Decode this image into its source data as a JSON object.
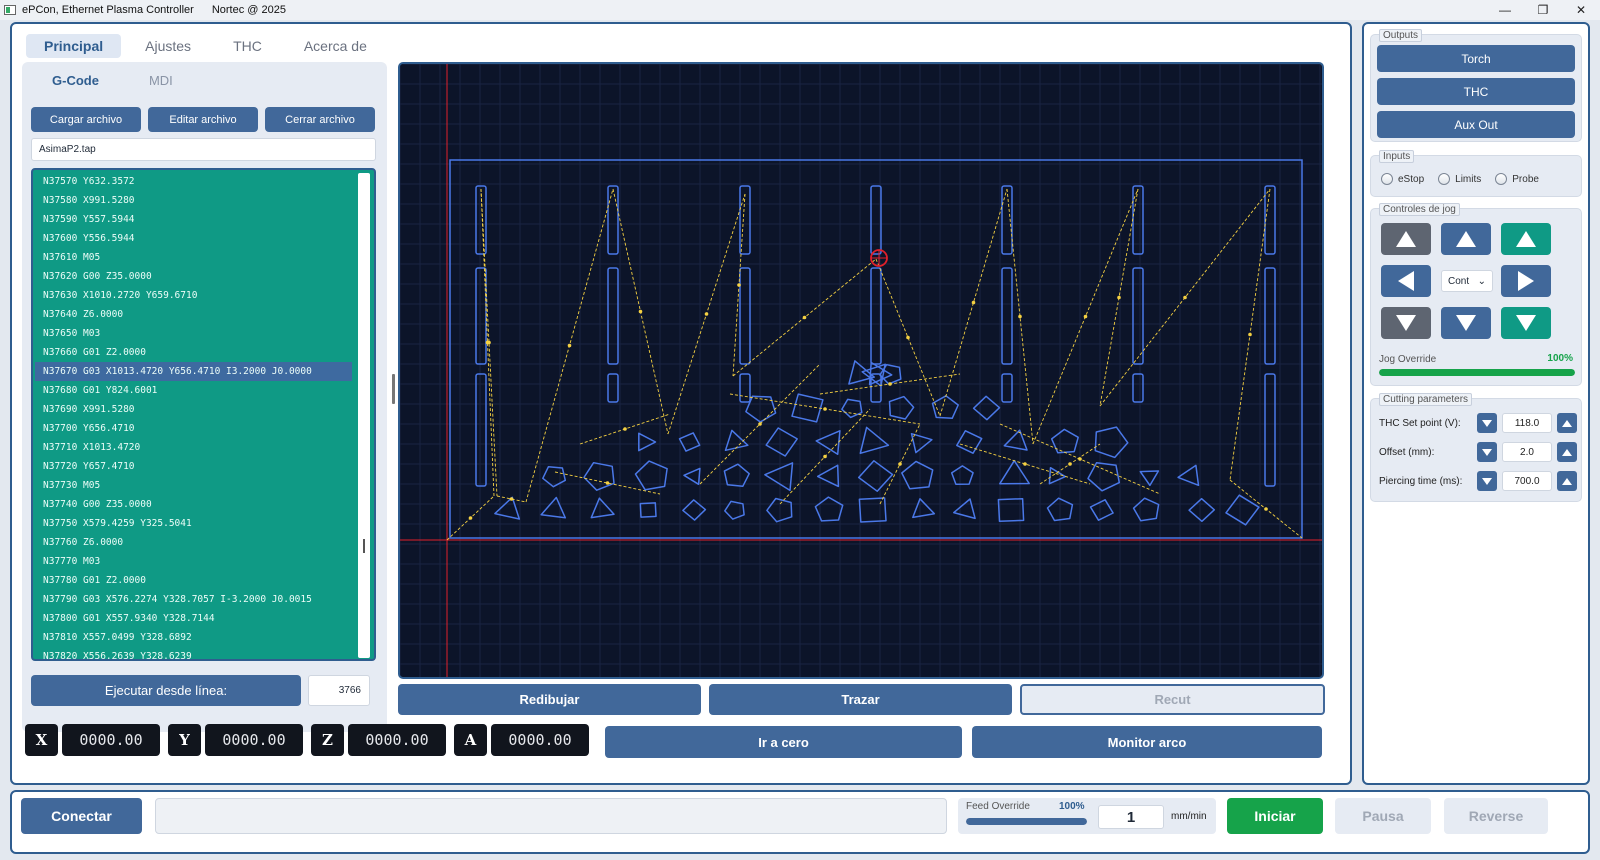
{
  "window": {
    "title": "ePCon, Ethernet Plasma Controller",
    "subtitle": "Nortec @ 2025",
    "minimize": "—",
    "maximize": "❐",
    "close": "✕"
  },
  "tabs": [
    "Principal",
    "Ajustes",
    "THC",
    "Acerca de"
  ],
  "subtabs": [
    "G-Code",
    "MDI"
  ],
  "file_buttons": {
    "load": "Cargar archivo",
    "edit": "Editar archivo",
    "close": "Cerrar archivo"
  },
  "file_name": "AsimaP2.tap",
  "gcode_lines": [
    "N37570  Y632.3572",
    "N37580  X991.5280",
    "N37590  Y557.5944",
    "N37600  Y556.5944",
    "N37610  M05",
    "N37620  G00 Z35.0000",
    "N37630  X1010.2720 Y659.6710",
    "N37640  Z6.0000",
    "N37650  M03",
    "N37660  G01 Z2.0000",
    "N37670  G03 X1013.4720 Y656.4710 I3.2000 J0.0000",
    "N37680  G01 Y824.6001",
    "N37690  X991.5280",
    "N37700  Y656.4710",
    "N37710  X1013.4720",
    "N37720  Y657.4710",
    "N37730  M05",
    "N37740  G00 Z35.0000",
    "N37750  X579.4259 Y325.5041",
    "N37760  Z6.0000",
    "N37770  M03",
    "N37780  G01 Z2.0000",
    "N37790  G03 X576.2274 Y328.7057 I-3.2000 J0.0015",
    "N37800  G01 X557.9340 Y328.7144",
    "N37810  X557.0499 Y328.6892",
    "N37820  X556.2639 Y328.6239"
  ],
  "highlighted_line_index": 10,
  "exec_button": "Ejecutar desde línea:",
  "exec_line": "3766",
  "view_buttons": {
    "redraw": "Redibujar",
    "trace": "Trazar",
    "recut": "Recut"
  },
  "dro": [
    {
      "axis": "X",
      "value": "0000.00"
    },
    {
      "axis": "Y",
      "value": "0000.00"
    },
    {
      "axis": "Z",
      "value": "0000.00"
    },
    {
      "axis": "A",
      "value": "0000.00"
    }
  ],
  "goto_zero": "Ir a cero",
  "arc_monitor": "Monitor arco",
  "outputs": {
    "label": "Outputs",
    "torch": "Torch",
    "thc": "THC",
    "aux": "Aux Out"
  },
  "inputs": {
    "label": "Inputs",
    "estop": "eStop",
    "limits": "Limits",
    "probe": "Probe"
  },
  "jog": {
    "label": "Controles de jog",
    "mode": "Cont",
    "override_label": "Jog Override",
    "override_value": "100%",
    "override_fraction": 1.0
  },
  "cutting": {
    "label": "Cutting parameters",
    "params": [
      {
        "label": "THC Set point (V):",
        "value": "118.0"
      },
      {
        "label": "Offset (mm):",
        "value": "2.0"
      },
      {
        "label": "Piercing time (ms):",
        "value": "700.0"
      }
    ]
  },
  "bottom": {
    "connect": "Conectar",
    "feed_label": "Feed Override",
    "feed_percent": "100%",
    "feed_fraction": 1.0,
    "feed_value": "1",
    "feed_unit": "mm/min",
    "start": "Iniciar",
    "pause": "Pausa",
    "reverse": "Reverse"
  },
  "colors": {
    "accent": "#41689a",
    "gcode_bg": "#0f9a85",
    "canvas_bg": "#0c1429",
    "toolpath": "#4a78e8",
    "rapid": "#f5d142",
    "origin_line": "#e0202a",
    "start_green": "#16a34a"
  }
}
